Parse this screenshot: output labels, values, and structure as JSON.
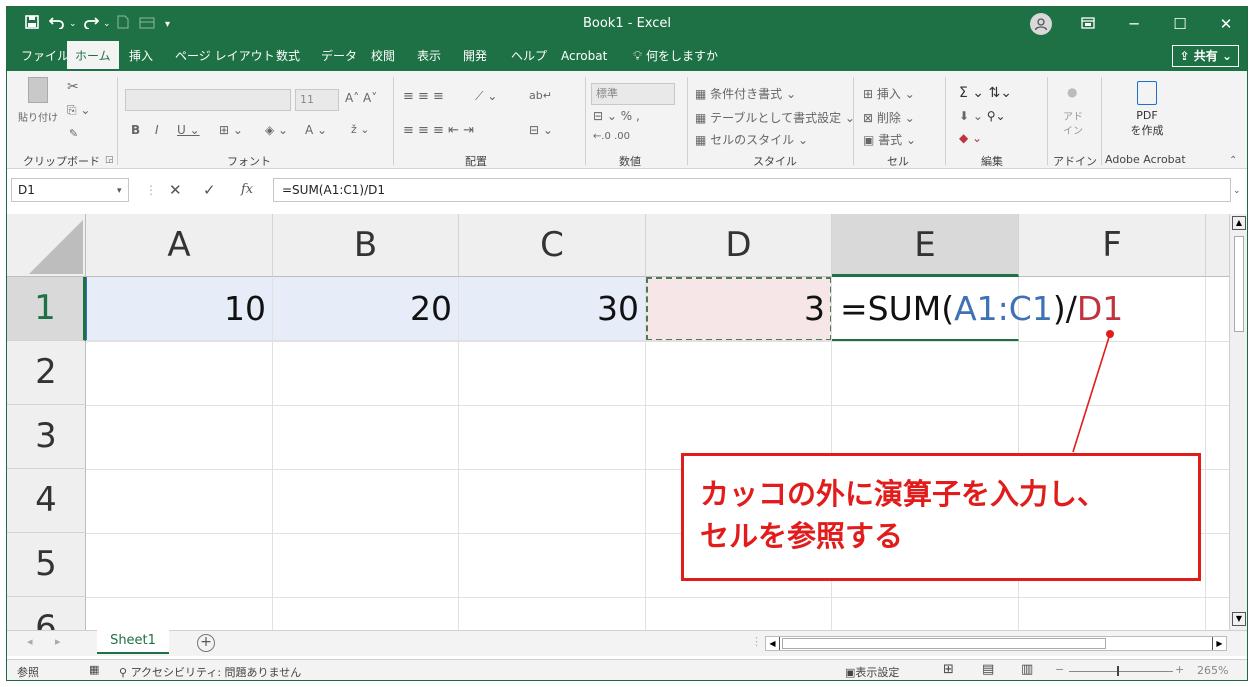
{
  "titlebar": {
    "title": "Book1  -  Excel",
    "save_icon": "save-icon",
    "undo_icon": "undo-icon",
    "redo_icon": "redo-icon",
    "user_icon": "user-icon",
    "ribbon_display_icon": "ribbon-display-icon",
    "minimize": "─",
    "maximize": "☐",
    "close": "✕"
  },
  "menu": {
    "tabs": [
      "ファイル",
      "ホーム",
      "挿入",
      "ページ レイアウト",
      "数式",
      "データ",
      "校閲",
      "表示",
      "開発",
      "ヘルプ",
      "Acrobat"
    ],
    "active": "ホーム",
    "search": "何をしますか",
    "share": "共有"
  },
  "ribbon": {
    "groups": [
      "クリップボード",
      "フォント",
      "配置",
      "数値",
      "スタイル",
      "セル",
      "編集",
      "アドイン",
      "Adobe Acrobat"
    ],
    "paste": "貼り付け",
    "font_size": "11",
    "number_format": "標準",
    "styles": [
      "条件付き書式",
      "テーブルとして書式設定",
      "セルのスタイル"
    ],
    "cells": [
      "挿入",
      "削除",
      "書式"
    ],
    "addin": "アド\nイン",
    "acrobat": [
      "PDF",
      "を作成"
    ]
  },
  "formula_bar": {
    "name_box": "D1",
    "formula": "=SUM(A1:C1)/D1",
    "cancel": "✕",
    "enter": "✓",
    "fx": "fx"
  },
  "sheet": {
    "columns": [
      "A",
      "B",
      "C",
      "D",
      "E",
      "F"
    ],
    "rows": [
      "1",
      "2",
      "3",
      "4",
      "5",
      "6"
    ],
    "selected_column": "E",
    "selected_row": "1",
    "cells": {
      "A1": "10",
      "B1": "20",
      "C1": "30",
      "D1": "3"
    },
    "edit_formula": {
      "prefix": "=SUM(",
      "ref1": "A1:C1",
      "mid": ")/",
      "ref2": "D1"
    },
    "ref_colors": {
      "range": "#3e71b5",
      "ref2": "#c0343f"
    }
  },
  "sheet_tabs": {
    "tabs": [
      "Sheet1"
    ],
    "add": "+"
  },
  "status": {
    "mode": "参照",
    "accessibility": "アクセシビリティ: 問題ありません",
    "display_settings": "表示設定",
    "zoom": "265%",
    "zoom_minus": "−",
    "zoom_plus": "+"
  },
  "callout": {
    "line1": "カッコの外に演算子を入力し、",
    "line2": "セルを参照する",
    "color": "#e21b1b"
  }
}
